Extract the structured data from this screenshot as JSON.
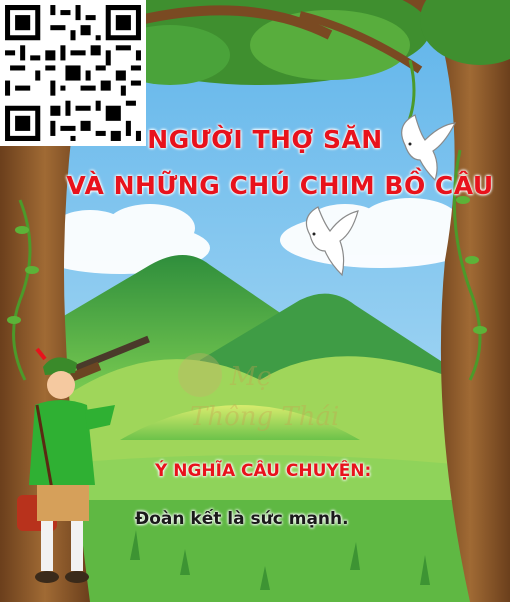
{
  "title": {
    "line1": "NGƯỜI THỢ SĂN",
    "line2": "VÀ NHỮNG CHÚ CHIM BỒ CÂU"
  },
  "moral": {
    "heading": "Ý NGHĨA CÂU CHUYỆN:",
    "text": "Đoàn kết là sức mạnh."
  },
  "watermark": "Mẹ Thông Thái",
  "colors": {
    "sky": "#7ec6ef",
    "title_red": "#e8121c",
    "mountain_green": "#3aa24a",
    "grass": "#6cc24a",
    "trunk": "#8a5a2b"
  },
  "icons": [
    "qr-code-icon",
    "dove-icon",
    "hunter-illustration",
    "tree-icon"
  ]
}
